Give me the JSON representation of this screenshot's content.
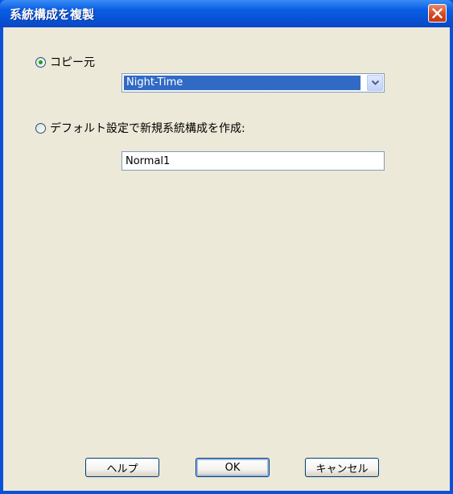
{
  "window": {
    "title": "系統構成を複製"
  },
  "options": {
    "copy_from_label": "コピー元",
    "copy_from_selected": true,
    "copy_source_value": "Night-Time",
    "create_default_label": "デフォルト設定で新規系統構成を作成:",
    "create_default_selected": false,
    "new_name_value": "Normal1"
  },
  "buttons": {
    "help": "ヘルプ",
    "ok": "OK",
    "cancel": "キャンセル"
  }
}
